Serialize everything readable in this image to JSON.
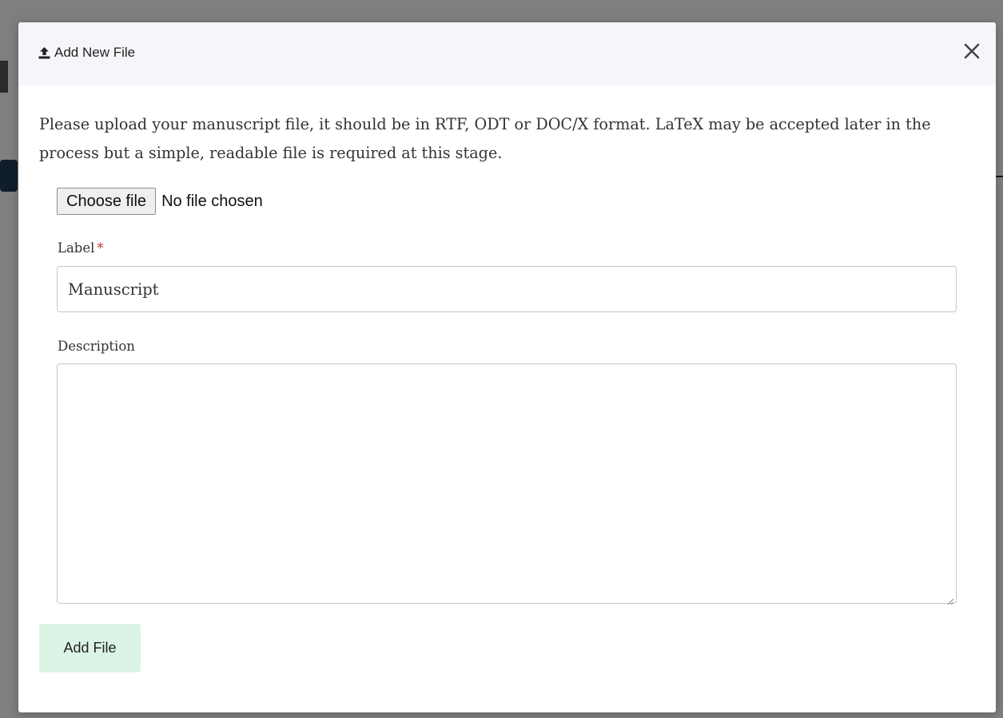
{
  "modal": {
    "title": "Add New File",
    "title_icon": "upload-icon",
    "close_icon": "close-icon",
    "intro": "Please upload your manuscript file, it should be in RTF, ODT or DOC/X format. LaTeX may be accepted later in the process but a simple, readable file is required at this stage.",
    "file_input": {
      "button_label": "Choose file",
      "status": "No file chosen"
    },
    "label_field": {
      "label": "Label",
      "required_marker": "*",
      "value": "Manuscript"
    },
    "description_field": {
      "label": "Description",
      "value": ""
    },
    "submit_label": "Add File"
  },
  "colors": {
    "header_bg": "#f5f6fa",
    "submit_bg": "#dcf4e6",
    "required": "#c0392b",
    "overlay": "rgba(0,0,0,0.5)"
  }
}
